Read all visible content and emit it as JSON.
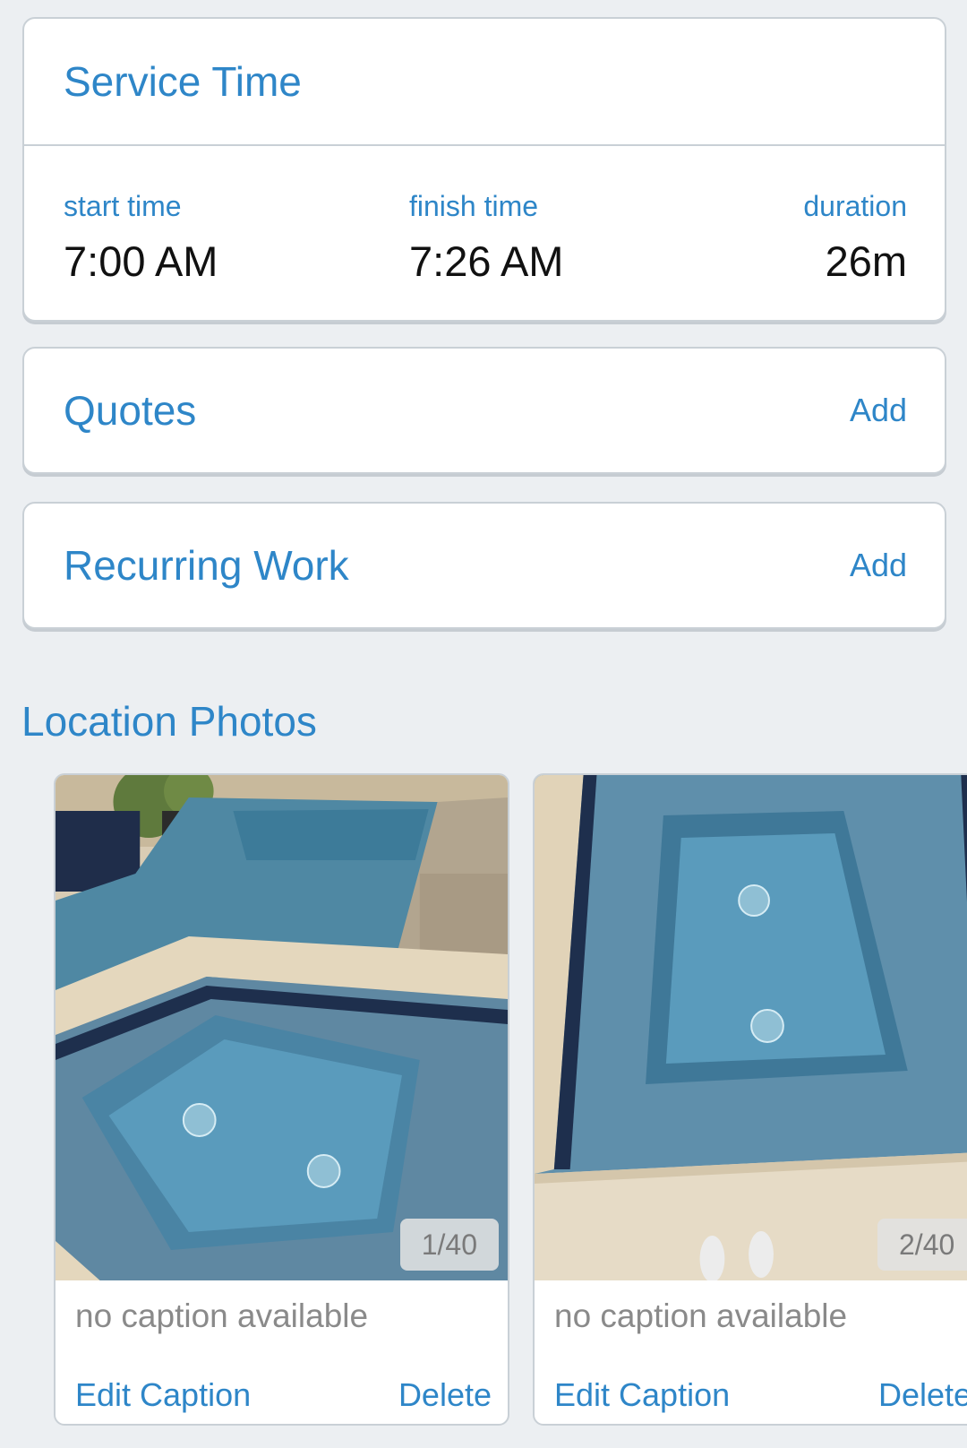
{
  "service_time": {
    "title": "Service Time",
    "start_label": "start time",
    "start_value": "7:00 AM",
    "finish_label": "finish time",
    "finish_value": "7:26 AM",
    "duration_label": "duration",
    "duration_value": "26m"
  },
  "quotes": {
    "title": "Quotes",
    "add_label": "Add"
  },
  "recurring_work": {
    "title": "Recurring Work",
    "add_label": "Add"
  },
  "location_photos": {
    "heading": "Location Photos",
    "photos": [
      {
        "counter": "1/40",
        "caption": "no caption available",
        "edit_label": "Edit Caption",
        "delete_label": "Delete"
      },
      {
        "counter": "2/40",
        "caption": "no caption available",
        "edit_label": "Edit Caption",
        "delete_label": "Delete"
      }
    ]
  },
  "colors": {
    "accent": "#2e86c8",
    "background": "#eceff2",
    "card": "#ffffff",
    "border": "#c9d0d6"
  }
}
